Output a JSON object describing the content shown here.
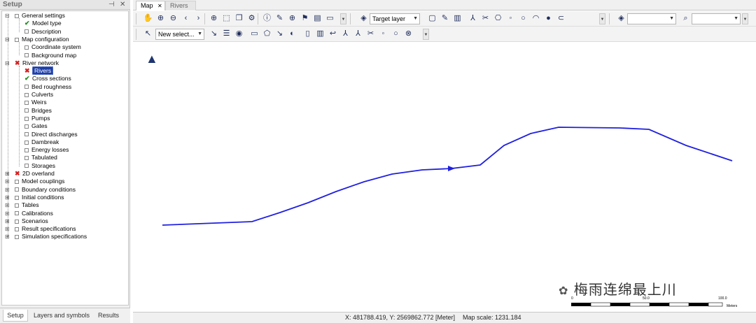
{
  "setup_panel": {
    "title": "Setup",
    "pin_glyph": "⊣",
    "close_glyph": "✕",
    "tree": [
      {
        "label": "General settings",
        "level": 0,
        "expander": "−",
        "status": "box"
      },
      {
        "label": "Model type",
        "level": 1,
        "status": "check"
      },
      {
        "label": "Description",
        "level": 1,
        "status": "box"
      },
      {
        "label": "Map configuration",
        "level": 0,
        "expander": "−",
        "status": "box"
      },
      {
        "label": "Coordinate system",
        "level": 1,
        "status": "box"
      },
      {
        "label": "Background map",
        "level": 1,
        "status": "box"
      },
      {
        "label": "River network",
        "level": 0,
        "expander": "−",
        "status": "x"
      },
      {
        "label": "Rivers",
        "level": 1,
        "status": "x",
        "selected": true
      },
      {
        "label": "Cross sections",
        "level": 1,
        "status": "check"
      },
      {
        "label": "Bed roughness",
        "level": 1,
        "status": "box"
      },
      {
        "label": "Culverts",
        "level": 1,
        "status": "box"
      },
      {
        "label": "Weirs",
        "level": 1,
        "status": "box"
      },
      {
        "label": "Bridges",
        "level": 1,
        "status": "box"
      },
      {
        "label": "Pumps",
        "level": 1,
        "status": "box"
      },
      {
        "label": "Gates",
        "level": 1,
        "status": "box"
      },
      {
        "label": "Direct discharges",
        "level": 1,
        "status": "box"
      },
      {
        "label": "Dambreak",
        "level": 1,
        "status": "box"
      },
      {
        "label": "Energy losses",
        "level": 1,
        "status": "box"
      },
      {
        "label": "Tabulated",
        "level": 1,
        "status": "box"
      },
      {
        "label": "Storages",
        "level": 1,
        "status": "box"
      },
      {
        "label": "2D overland",
        "level": 0,
        "expander": "+",
        "status": "x"
      },
      {
        "label": "Model couplings",
        "level": 0,
        "expander": "+",
        "status": "box"
      },
      {
        "label": "Boundary conditions",
        "level": 0,
        "expander": "+",
        "status": "box"
      },
      {
        "label": "Initial conditions",
        "level": 0,
        "expander": "+",
        "status": "box"
      },
      {
        "label": "Tables",
        "level": 0,
        "expander": "+",
        "status": "box"
      },
      {
        "label": "Calibrations",
        "level": 0,
        "expander": "+",
        "status": "box"
      },
      {
        "label": "Scenarios",
        "level": 0,
        "expander": "+",
        "status": "box"
      },
      {
        "label": "Result specifications",
        "level": 0,
        "expander": "+",
        "status": "box"
      },
      {
        "label": "Simulation specifications",
        "level": 0,
        "expander": "+",
        "status": "box"
      }
    ],
    "bottom_tabs": [
      "Setup",
      "Layers and symbols",
      "Results"
    ]
  },
  "doc_tabs": [
    {
      "label": "Map",
      "close": "✕",
      "active": true
    },
    {
      "label": "Rivers",
      "active": false
    }
  ],
  "toolbar1": {
    "icons": [
      "pan-icon",
      "zoom-in-icon",
      "zoom-out-icon",
      "back-icon",
      "forward-icon",
      "globe-icon",
      "zoom-extent-icon",
      "copy-map-icon",
      "settings-icon",
      "info-icon",
      "measure-icon",
      "crosshair-icon",
      "flag-icon",
      "chart-icon",
      "ruler-icon"
    ],
    "glyphs": [
      "✋",
      "⊕",
      "⊖",
      "‹",
      "›",
      "⊕",
      "⬚",
      "❐",
      "⚙",
      "ⓘ",
      "✎",
      "⊕",
      "⚑",
      "▤",
      "▭"
    ],
    "layers_glyph": "◈",
    "target_layer_label": "Target layer",
    "edit_glyphs": [
      "▢",
      "✎",
      "▥",
      "⅄",
      "✂",
      "⎔",
      "◦",
      "○",
      "◠",
      "●",
      "⊂"
    ],
    "right_layers_glyph": "◈",
    "search_glyph": "⌕"
  },
  "toolbar2": {
    "select_glyph": "↖",
    "new_select_label": "New select...",
    "glyphs": [
      "↘",
      "☰",
      "◉",
      "▭",
      "⬠",
      "↘",
      "◐",
      "▯",
      "▥",
      "↩",
      "⅄",
      "⅄",
      "✂",
      "◦",
      "○",
      "⊗"
    ]
  },
  "map": {
    "north_arrow_glyph": "▲",
    "river_color": "#2020e0",
    "watermark_text": "梅雨连绵最上川",
    "scale_labels": [
      "0",
      "50.0",
      "100.0"
    ],
    "scale_unit": "Meters"
  },
  "status": {
    "coords": "X: 481788.419, Y: 2569862.772 [Meter]",
    "scale": "Map scale: 1231.184"
  }
}
